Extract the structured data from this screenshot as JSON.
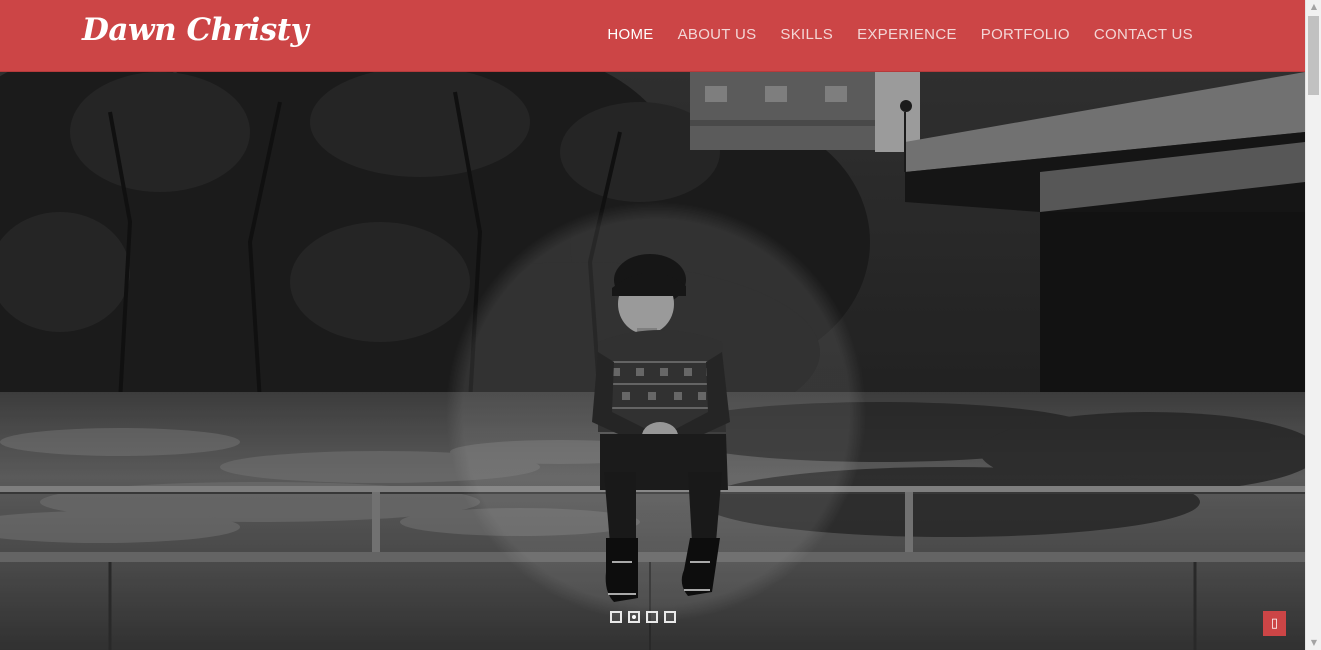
{
  "brand": {
    "name": "Dawn Christy"
  },
  "nav": {
    "items": [
      {
        "label": "HOME",
        "active": true
      },
      {
        "label": "ABOUT US",
        "active": false
      },
      {
        "label": "SKILLS",
        "active": false
      },
      {
        "label": "EXPERIENCE",
        "active": false
      },
      {
        "label": "PORTFOLIO",
        "active": false
      },
      {
        "label": "CONTACT US",
        "active": false
      }
    ]
  },
  "hero": {
    "slides_total": 4,
    "active_slide": 2
  },
  "back_to_top": {
    "icon": "mobile-icon",
    "glyph": "▯"
  },
  "colors": {
    "accent": "#cc4546",
    "nav_text": "#f3d6d6",
    "nav_active": "#ffffff"
  }
}
